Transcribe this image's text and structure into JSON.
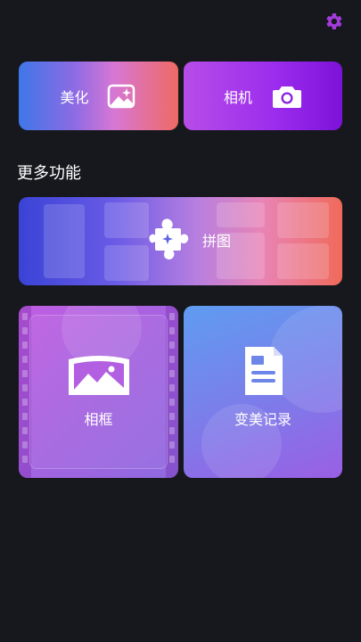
{
  "header": {
    "settings_icon": "gear-icon",
    "accent_color": "#a23bdb"
  },
  "top_cards": {
    "beautify": {
      "label": "美化",
      "icon": "sparkle-image-icon"
    },
    "camera": {
      "label": "相机",
      "icon": "camera-icon"
    }
  },
  "section": {
    "title": "更多功能"
  },
  "features": {
    "collage": {
      "label": "拼图",
      "icon": "puzzle-icon"
    },
    "frame": {
      "label": "相框",
      "icon": "picture-frame-icon"
    },
    "history": {
      "label": "变美记录",
      "icon": "document-icon"
    }
  }
}
